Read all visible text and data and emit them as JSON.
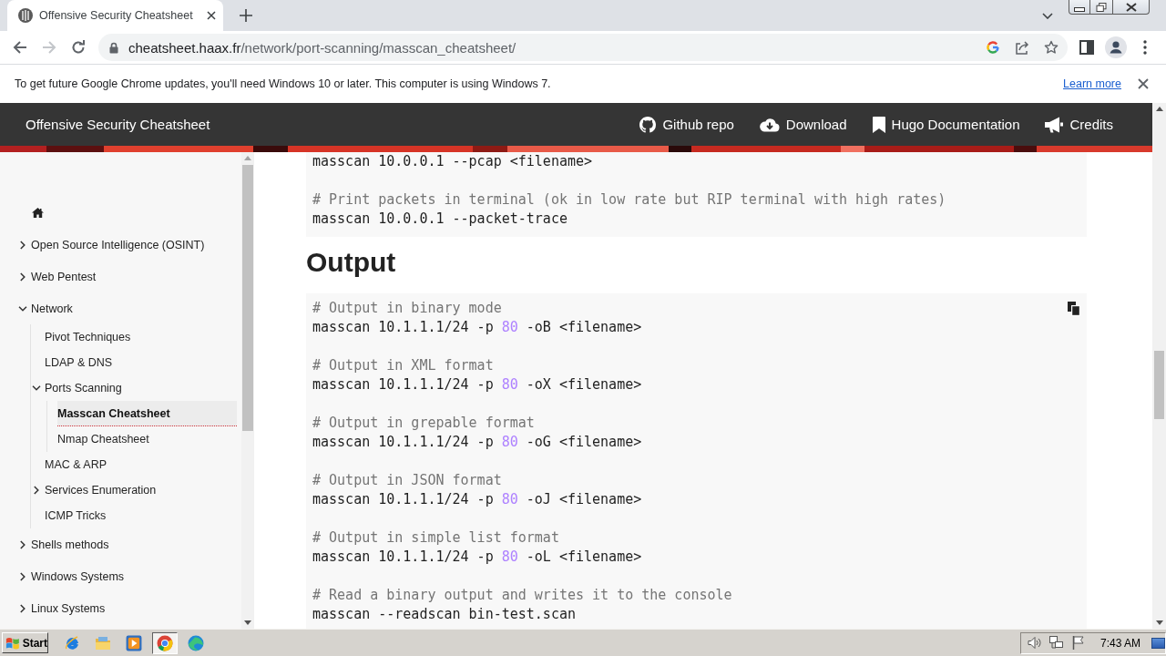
{
  "browser": {
    "tabs": [
      {
        "title": "Offensive Security Cheatsheet",
        "selected": true
      }
    ],
    "nav": [
      {
        "kind": "back",
        "disabled": false
      },
      {
        "kind": "forward",
        "disabled": true
      },
      {
        "kind": "reload",
        "disabled": false
      }
    ],
    "url": {
      "host": "cheatsheet.haax.fr",
      "path": "/network/port-scanning/masscan_cheatsheet/"
    }
  },
  "infobar": {
    "message": "To get future Google Chrome updates, you'll need Windows 10 or later. This computer is using Windows 7.",
    "link": "Learn more"
  },
  "site_header": {
    "title": "Offensive Security Cheatsheet",
    "links": [
      {
        "kind": "github",
        "label": "Github repo"
      },
      {
        "kind": "download",
        "label": "Download"
      },
      {
        "kind": "docs",
        "label": "Hugo Documentation"
      },
      {
        "kind": "credits",
        "label": "Credits"
      }
    ]
  },
  "sidebar": {
    "items": [
      {
        "kind": "section",
        "label": "Open Source Intelligence (OSINT)",
        "expanded": false,
        "selected": false
      },
      {
        "kind": "section",
        "label": "Web Pentest",
        "expanded": false,
        "selected": false
      },
      {
        "kind": "section",
        "label": "Network",
        "expanded": true,
        "selected": false,
        "children": [
          {
            "kind": "page",
            "label": "Pivot Techniques",
            "selected": false
          },
          {
            "kind": "page",
            "label": "LDAP & DNS",
            "selected": false
          },
          {
            "kind": "section",
            "label": "Ports Scanning",
            "expanded": true,
            "selected": false,
            "children": [
              {
                "kind": "page",
                "label": "Masscan Cheatsheet",
                "selected": true
              },
              {
                "kind": "page",
                "label": "Nmap Cheatsheet",
                "selected": false
              }
            ]
          },
          {
            "kind": "page",
            "label": "MAC & ARP",
            "selected": false
          },
          {
            "kind": "section",
            "label": "Services Enumeration",
            "expanded": false,
            "selected": false
          },
          {
            "kind": "page",
            "label": "ICMP Tricks",
            "selected": false
          }
        ]
      },
      {
        "kind": "section",
        "label": "Shells methods",
        "expanded": false,
        "selected": false
      },
      {
        "kind": "section",
        "label": "Windows Systems",
        "expanded": false,
        "selected": false
      },
      {
        "kind": "section",
        "label": "Linux Systems",
        "expanded": false,
        "selected": false
      }
    ]
  },
  "content": {
    "blocks": [
      {
        "kind": "code",
        "copy_button": false,
        "groups": [
          {
            "command": [
              {
                "kind": "plain",
                "text": "masscan 10.0.0.1 --pcap <filename>"
              }
            ]
          },
          {
            "comment": "# Print packets in terminal (ok in low rate but RIP terminal with high rates)",
            "command": [
              {
                "kind": "plain",
                "text": "masscan 10.0.0.1 --packet-trace"
              }
            ]
          }
        ]
      },
      {
        "kind": "heading",
        "text": "Output"
      },
      {
        "kind": "code",
        "copy_button": true,
        "groups": [
          {
            "comment": "# Output in binary mode",
            "command": [
              {
                "kind": "plain",
                "text": "masscan 10.1.1.1/24 -p "
              },
              {
                "kind": "number",
                "text": "80"
              },
              {
                "kind": "plain",
                "text": " -oB <filename>"
              }
            ]
          },
          {
            "comment": "# Output in XML format",
            "command": [
              {
                "kind": "plain",
                "text": "masscan 10.1.1.1/24 -p "
              },
              {
                "kind": "number",
                "text": "80"
              },
              {
                "kind": "plain",
                "text": " -oX <filename>"
              }
            ]
          },
          {
            "comment": "# Output in grepable format",
            "command": [
              {
                "kind": "plain",
                "text": "masscan 10.1.1.1/24 -p "
              },
              {
                "kind": "number",
                "text": "80"
              },
              {
                "kind": "plain",
                "text": " -oG <filename>"
              }
            ]
          },
          {
            "comment": "# Output in JSON format",
            "command": [
              {
                "kind": "plain",
                "text": "masscan 10.1.1.1/24 -p "
              },
              {
                "kind": "number",
                "text": "80"
              },
              {
                "kind": "plain",
                "text": " -oJ <filename>"
              }
            ]
          },
          {
            "comment": "# Output in simple list format",
            "command": [
              {
                "kind": "plain",
                "text": "masscan 10.1.1.1/24 -p "
              },
              {
                "kind": "number",
                "text": "80"
              },
              {
                "kind": "plain",
                "text": " -oL <filename>"
              }
            ]
          },
          {
            "comment": "# Read a binary output and writes it to the console",
            "command": [
              {
                "kind": "plain",
                "text": "masscan --readscan bin-test.scan"
              }
            ]
          }
        ]
      }
    ]
  },
  "taskbar": {
    "start": "Start",
    "apps": [
      {
        "kind": "ie",
        "selected": false
      },
      {
        "kind": "explorer",
        "selected": false
      },
      {
        "kind": "media_player",
        "selected": false
      },
      {
        "kind": "chrome",
        "selected": true
      },
      {
        "kind": "edge",
        "selected": false
      }
    ],
    "clock": "7:43 AM"
  }
}
